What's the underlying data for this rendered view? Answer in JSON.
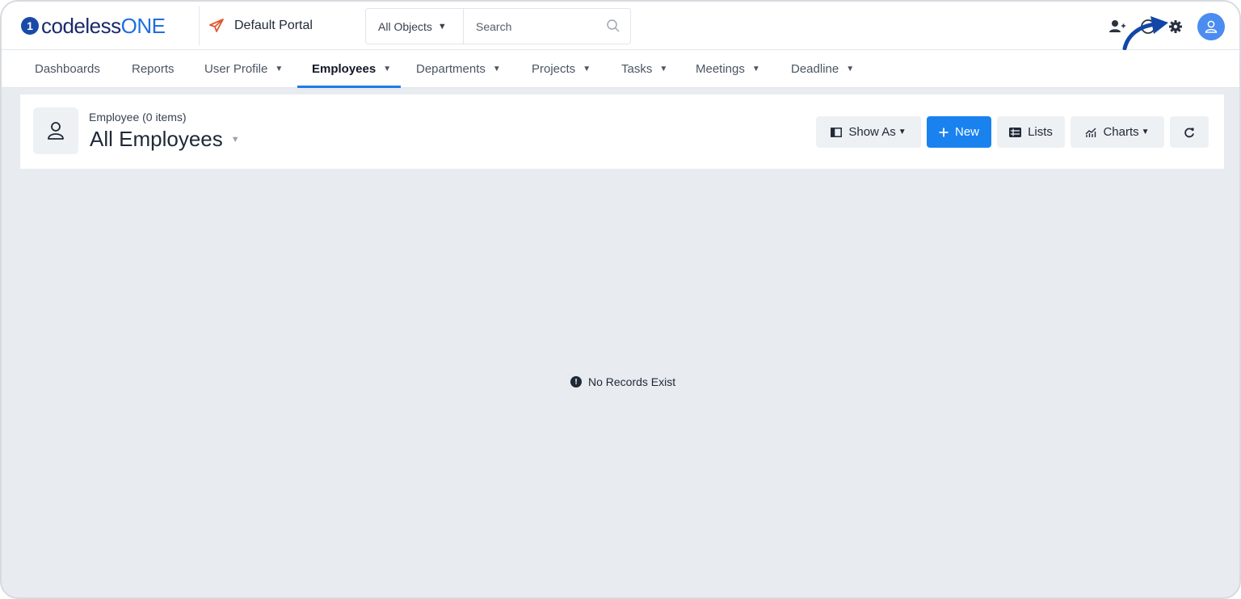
{
  "brand": {
    "mark": "1",
    "name_main": "codeless",
    "name_accent": "ONE"
  },
  "portal": {
    "label": "Default Portal"
  },
  "search": {
    "object_select": "All Objects",
    "placeholder": "Search"
  },
  "nav": {
    "items": [
      {
        "label": "Dashboards",
        "has_menu": false
      },
      {
        "label": "Reports",
        "has_menu": false
      },
      {
        "label": "User Profile",
        "has_menu": true
      },
      {
        "label": "Employees",
        "has_menu": true,
        "active": true
      },
      {
        "label": "Departments",
        "has_menu": true
      },
      {
        "label": "Projects",
        "has_menu": true
      },
      {
        "label": "Tasks",
        "has_menu": true
      },
      {
        "label": "Meetings",
        "has_menu": true
      },
      {
        "label": "Deadline",
        "has_menu": true
      }
    ]
  },
  "header": {
    "subtitle": "Employee (0 items)",
    "title": "All Employees"
  },
  "toolbar": {
    "show_as": "Show As",
    "new": "New",
    "lists": "Lists",
    "charts": "Charts"
  },
  "empty_state": {
    "message": "No Records Exist",
    "icon": "!"
  },
  "colors": {
    "accent": "#1a82ef",
    "brand_dark": "#1a2a6c",
    "brand_blue": "#1e6fe0",
    "portal_icon": "#e0572b",
    "background": "#e8ebef"
  },
  "icons": [
    "add-user-icon",
    "help-icon",
    "gear-icon",
    "user-avatar-icon",
    "search-icon",
    "paper-plane-icon",
    "refresh-icon"
  ]
}
